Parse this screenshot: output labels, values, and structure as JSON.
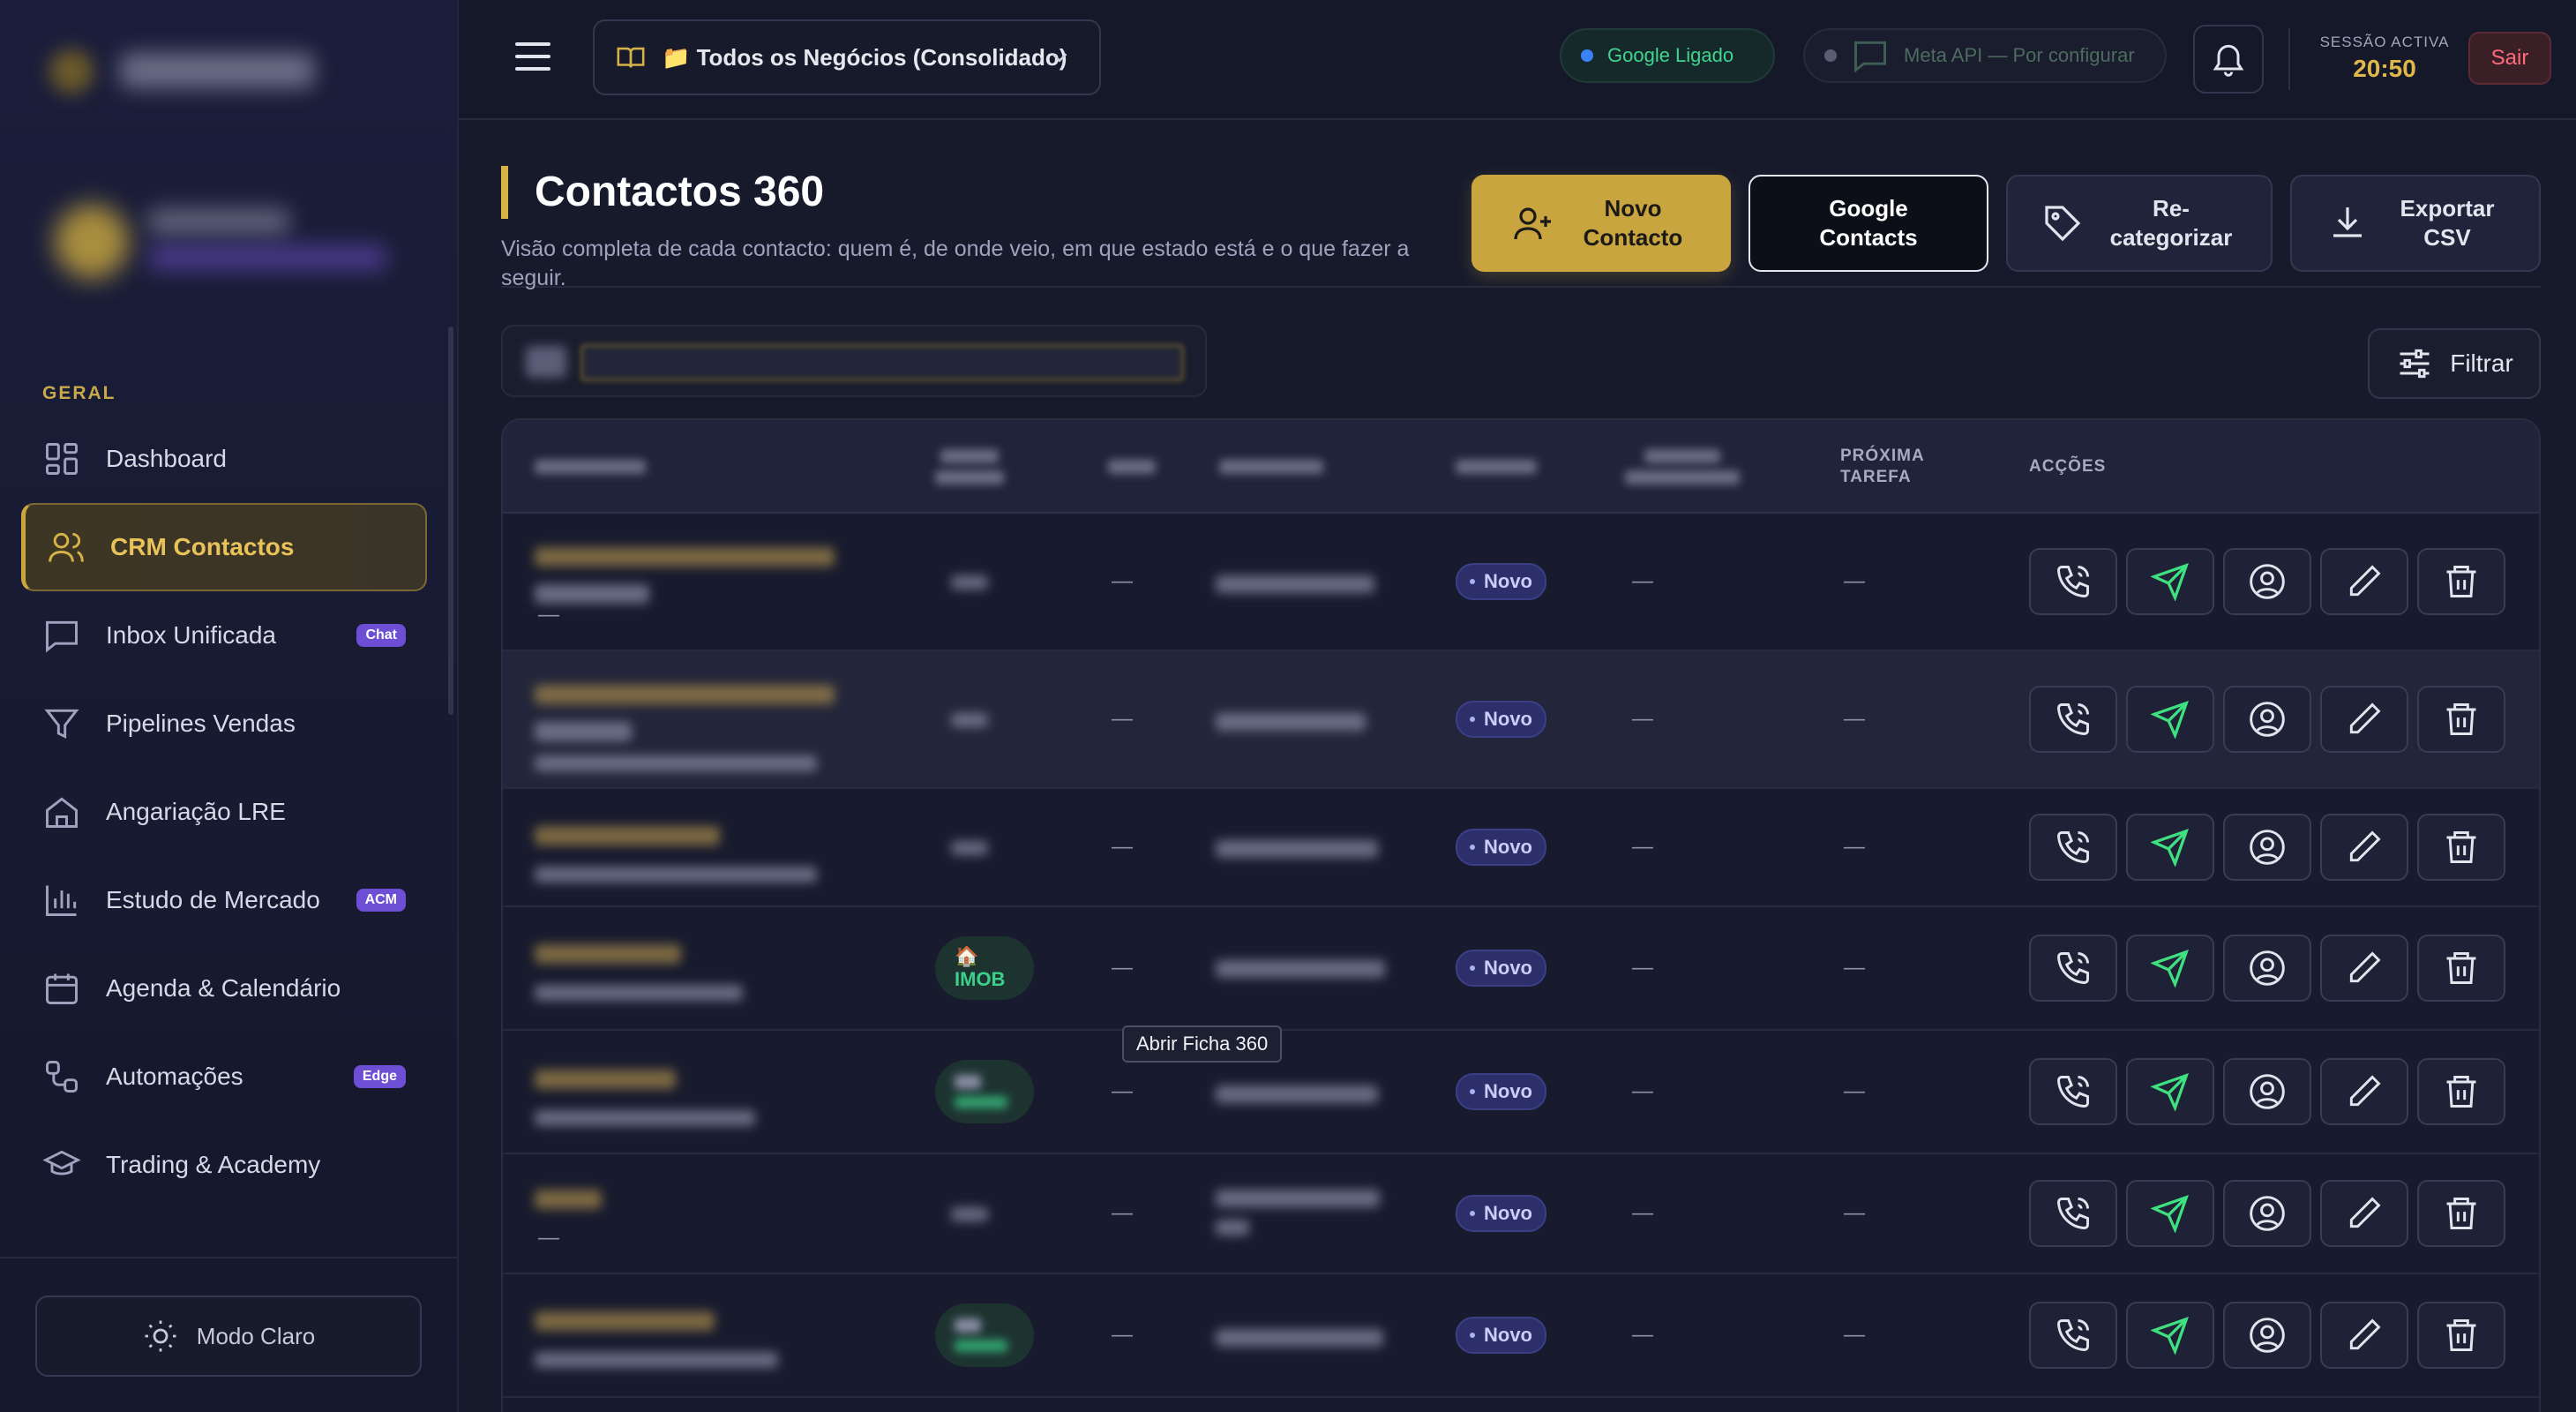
{
  "sidebar": {
    "section_label": "GERAL",
    "items": [
      {
        "label": "Dashboard",
        "icon": "grid-icon"
      },
      {
        "label": "CRM Contactos",
        "icon": "users-icon",
        "active": true
      },
      {
        "label": "Inbox Unificada",
        "icon": "chat-icon",
        "badge": "Chat"
      },
      {
        "label": "Pipelines Vendas",
        "icon": "funnel-icon"
      },
      {
        "label": "Angariação LRE",
        "icon": "home-icon"
      },
      {
        "label": "Estudo de Mercado",
        "icon": "bar-chart-icon",
        "badge": "ACM"
      },
      {
        "label": "Agenda & Calendário",
        "icon": "calendar-icon"
      },
      {
        "label": "Automações",
        "icon": "workflow-icon",
        "badge": "Edge"
      },
      {
        "label": "Trading & Academy",
        "icon": "graduation-cap-icon"
      }
    ],
    "mode_button": "Modo Claro"
  },
  "topbar": {
    "business_select": "📁 Todos os Negócios (Consolidado)",
    "google_status": "Google Ligado",
    "meta_status": "Meta API — Por configurar",
    "session_label": "SESSÃO ACTIVA",
    "session_time": "20:50",
    "logout": "Sair"
  },
  "page": {
    "title": "Contactos 360",
    "subtitle": "Visão completa de cada contacto: quem é, de onde veio, em que estado está e o que fazer a seguir.",
    "buttons": {
      "new_contact": "Novo Contacto",
      "google_contacts": "Google Contacts",
      "recategorize": "Re-categorizar",
      "export_csv": "Exportar CSV"
    },
    "filter": "Filtrar"
  },
  "table": {
    "headers": {
      "next_task": "PRÓXIMA TAREFA",
      "actions": "ACÇÕES"
    },
    "dash": "—",
    "status_new": "Novo",
    "source_imob": "🏠 IMOB",
    "tooltip": "Abrir Ficha 360"
  },
  "colors": {
    "accent_gold": "#c9a540",
    "status_purple": "#2c2f6a",
    "send_green": "#3ee07f",
    "logout_red": "#ff6b7a"
  }
}
